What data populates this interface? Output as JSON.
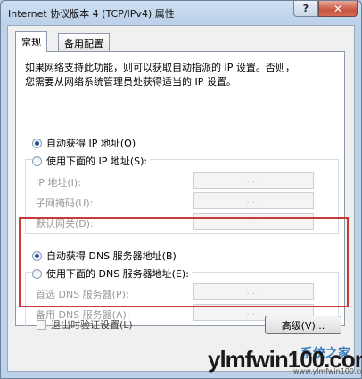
{
  "window": {
    "title": "Internet 协议版本 4 (TCP/IPv4) 属性",
    "help_label": "?",
    "close_label": "✕"
  },
  "tabs": [
    {
      "label": "常规",
      "active": true
    },
    {
      "label": "备用配置",
      "active": false
    }
  ],
  "description": {
    "line1": "如果网络支持此功能，则可以获取自动指派的 IP 设置。否则，",
    "line2": "您需要从网络系统管理员处获得适当的 IP 设置。"
  },
  "ip_section": {
    "auto_label": "自动获得 IP 地址(O)",
    "manual_label": "使用下面的 IP 地址(S):",
    "auto_selected": true,
    "fields": [
      {
        "label": "IP 地址(I):",
        "value": ". . ."
      },
      {
        "label": "子网掩码(U):",
        "value": ". . ."
      },
      {
        "label": "默认网关(D):",
        "value": ". . ."
      }
    ]
  },
  "dns_section": {
    "auto_label": "自动获得 DNS 服务器地址(B)",
    "manual_label": "使用下面的 DNS 服务器地址(E):",
    "auto_selected": true,
    "fields": [
      {
        "label": "首选 DNS 服务器(P):",
        "value": ". . ."
      },
      {
        "label": "备用 DNS 服务器(A):",
        "value": ". . ."
      }
    ]
  },
  "footer": {
    "validate_label": "退出时验证设置(L)",
    "validate_checked": false,
    "advanced_label": "高级(V)..."
  },
  "watermark": {
    "brand": "ylmfwin100.com",
    "tag": "系统之家",
    "url": "www.ylmfwin100.com"
  },
  "colors": {
    "highlight_border": "#c8393a",
    "radio_dot": "#1f4f9a"
  }
}
